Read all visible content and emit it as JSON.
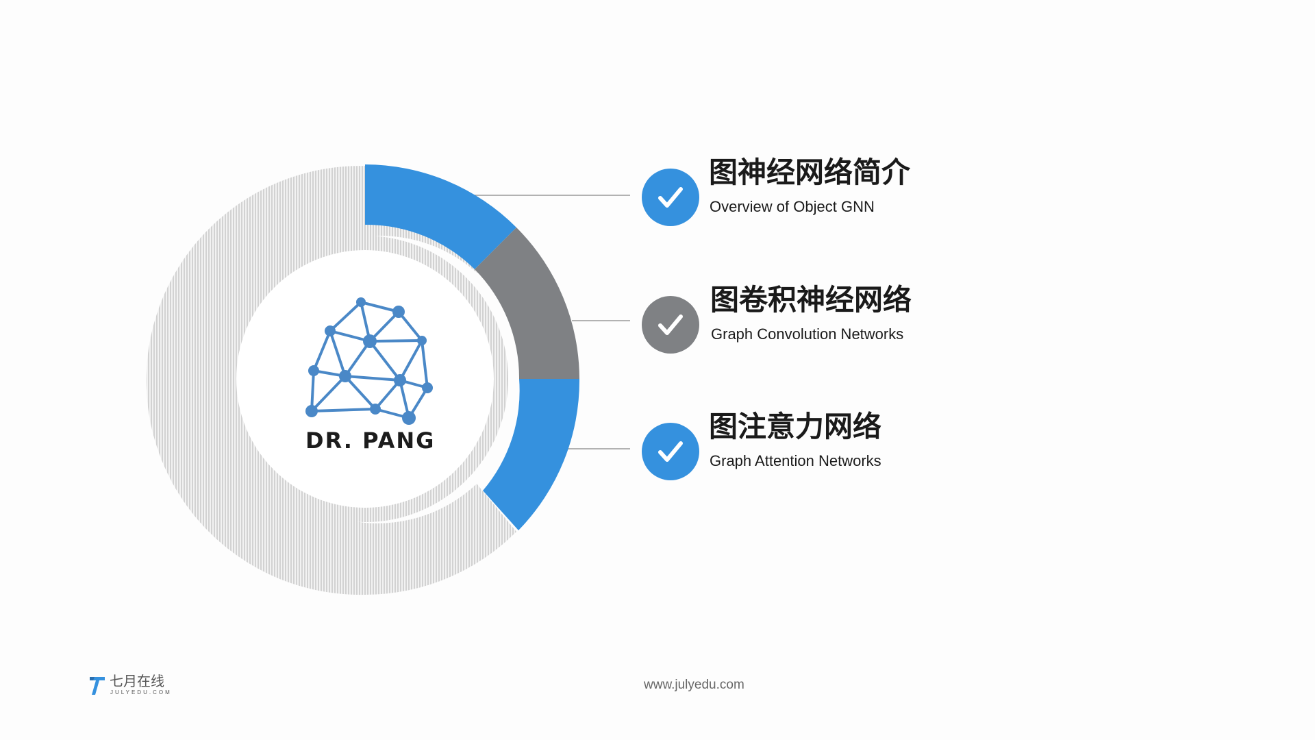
{
  "colors": {
    "accent_blue": "#3591de",
    "accent_gray": "#7f8184",
    "ring_light": "#dcdcdc",
    "connector_line": "#9a9a9a",
    "logo_blue": "#4a88c7",
    "logo_dark": "#1c1c1c"
  },
  "center_logo": {
    "text": "DR. PANG",
    "icon": "network-graph-icon"
  },
  "items": [
    {
      "title": "图神经网络简介",
      "subtitle": "Overview of Object GNN",
      "icon": "checkmark-icon",
      "color": "#3591de"
    },
    {
      "title": "图卷积神经网络",
      "subtitle": "Graph Convolution Networks",
      "icon": "checkmark-icon",
      "color": "#7f8184"
    },
    {
      "title": "图注意力网络",
      "subtitle": "Graph Attention Networks",
      "icon": "checkmark-icon",
      "color": "#3591de"
    }
  ],
  "footer": {
    "brand_cn": "七月在线",
    "brand_en": "JULYEDU.COM",
    "brand_icon": "julyedu-logo-icon",
    "url": "www.julyedu.com"
  }
}
